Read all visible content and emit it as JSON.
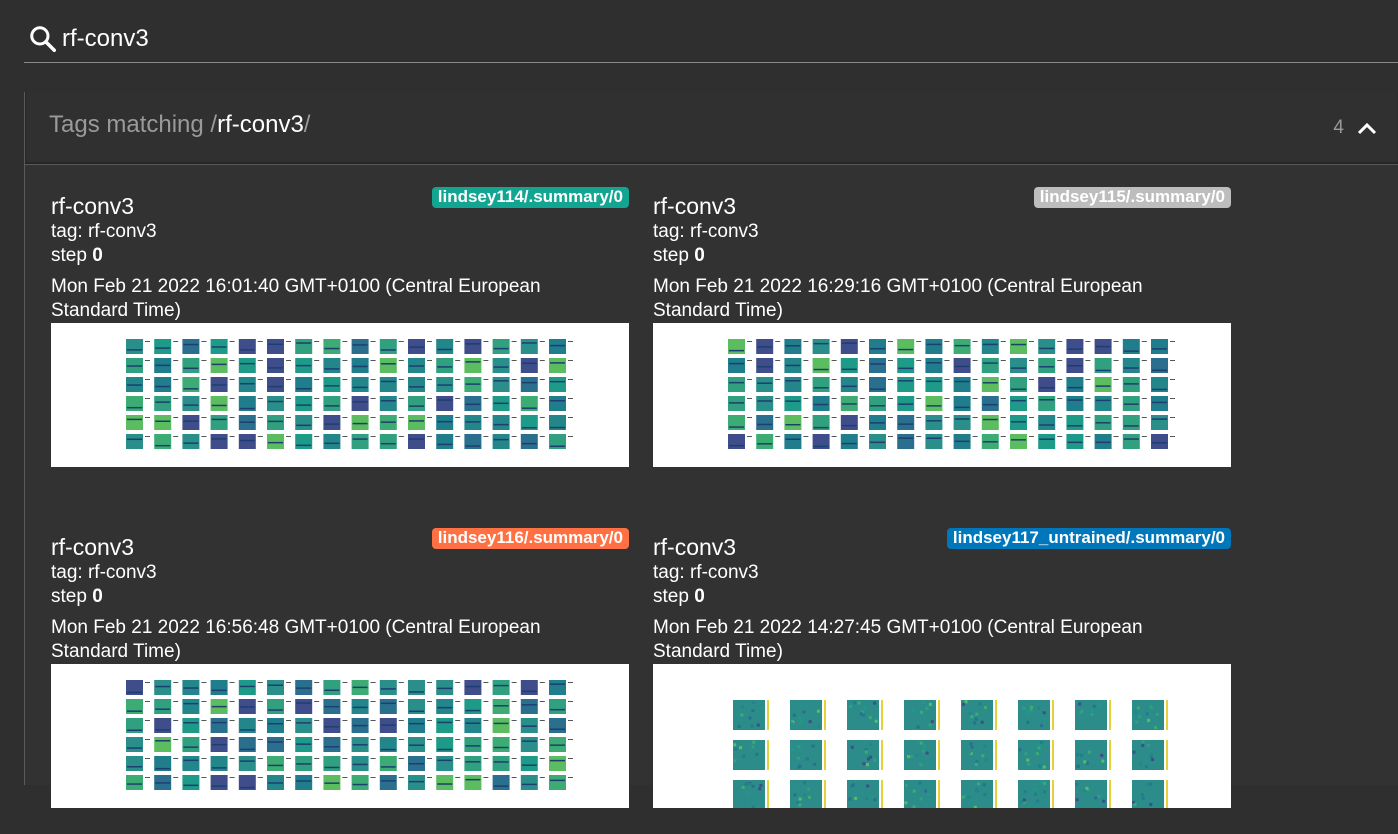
{
  "search": {
    "value": "rf-conv3",
    "icon": "search-icon"
  },
  "panel": {
    "title_prefix": "Tags matching /",
    "title_regex": "rf-conv3",
    "title_suffix": "/",
    "count": "4",
    "collapse_icon": "chevron-up-icon"
  },
  "cards": [
    {
      "title": "rf-conv3",
      "tag": "tag: rf-conv3",
      "step_label": "step ",
      "step": "0",
      "time": "Mon Feb 21 2022 16:01:40 GMT+0100 (Central European Standard Time)",
      "run": "lindsey114/.summary/0",
      "run_color": "#12a591",
      "image": "filter-grid"
    },
    {
      "title": "rf-conv3",
      "tag": "tag: rf-conv3",
      "step_label": "step ",
      "step": "0",
      "time": "Mon Feb 21 2022 16:29:16 GMT+0100 (Central European Standard Time)",
      "run": "lindsey115/.summary/0",
      "run_color": "#bdbdbd",
      "image": "filter-grid"
    },
    {
      "title": "rf-conv3",
      "tag": "tag: rf-conv3",
      "step_label": "step ",
      "step": "0",
      "time": "Mon Feb 21 2022 16:56:48 GMT+0100 (Central European Standard Time)",
      "run": "lindsey116/.summary/0",
      "run_color": "#ff7043",
      "image": "filter-grid"
    },
    {
      "title": "rf-conv3",
      "tag": "tag: rf-conv3",
      "step_label": "step ",
      "step": "0",
      "time": "Mon Feb 21 2022 14:27:45 GMT+0100 (Central European Standard Time)",
      "run": "lindsey117_untrained/.summary/0",
      "run_color": "#0077bb",
      "image": "filter-grid-large"
    }
  ]
}
